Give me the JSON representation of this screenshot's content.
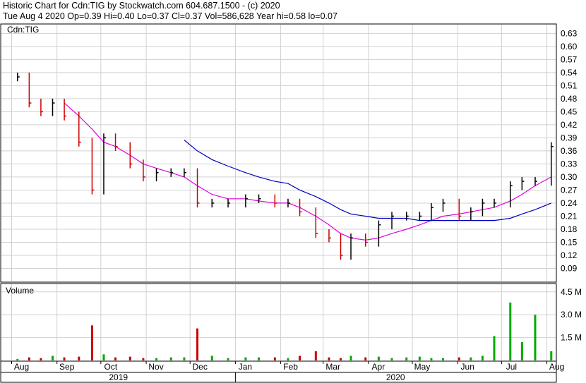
{
  "header": {
    "line1": "Historic Chart for Cdn:TIG by Stockwatch.com 604.687.1500 - (c) 2020",
    "line2": "Tue Aug  4 2020  Op=0.39  Hi=0.40  Lo=0.37  Cl=0.37  Vol=586,628  Year hi=0.58  lo=0.07"
  },
  "chart_data": [
    {
      "type": "ohlc",
      "title": "Cdn:TIG",
      "xlabel": "",
      "ylabel": "",
      "x": [
        "2019-08-05",
        "2019-08-13",
        "2019-08-21",
        "2019-08-29",
        "2019-09-06",
        "2019-09-16",
        "2019-09-25",
        "2019-10-03",
        "2019-10-11",
        "2019-10-21",
        "2019-10-30",
        "2019-11-08",
        "2019-11-18",
        "2019-11-27",
        "2019-12-06",
        "2019-12-16",
        "2019-12-27",
        "2020-01-08",
        "2020-01-17",
        "2020-01-28",
        "2020-02-06",
        "2020-02-14",
        "2020-02-25",
        "2020-03-05",
        "2020-03-13",
        "2020-03-20",
        "2020-03-30",
        "2020-04-08",
        "2020-04-17",
        "2020-04-27",
        "2020-05-06",
        "2020-05-14",
        "2020-05-22",
        "2020-06-02",
        "2020-06-10",
        "2020-06-18",
        "2020-06-26",
        "2020-07-07",
        "2020-07-15",
        "2020-07-24",
        "2020-08-04"
      ],
      "close": [
        0.53,
        0.47,
        0.45,
        0.47,
        0.44,
        0.38,
        0.27,
        0.39,
        0.37,
        0.33,
        0.3,
        0.31,
        0.31,
        0.31,
        0.24,
        0.24,
        0.24,
        0.25,
        0.25,
        0.24,
        0.24,
        0.22,
        0.17,
        0.16,
        0.12,
        0.16,
        0.15,
        0.19,
        0.21,
        0.21,
        0.21,
        0.23,
        0.24,
        0.21,
        0.22,
        0.24,
        0.24,
        0.28,
        0.29,
        0.29,
        0.37
      ],
      "volume_millions": [
        0.1,
        0.2,
        0.15,
        0.3,
        0.2,
        0.25,
        2.3,
        0.4,
        0.2,
        0.25,
        0.15,
        0.15,
        0.2,
        0.2,
        2.1,
        0.3,
        0.15,
        0.2,
        0.2,
        0.2,
        0.15,
        0.3,
        0.6,
        0.2,
        0.15,
        0.3,
        0.2,
        0.25,
        0.15,
        0.2,
        0.25,
        0.15,
        0.15,
        0.2,
        0.2,
        0.3,
        1.6,
        3.8,
        1.2,
        3.0,
        0.6
      ],
      "moving_averages": [
        {
          "color": "#e000e0",
          "values": [
            null,
            null,
            null,
            null,
            0.47,
            0.44,
            0.41,
            0.38,
            0.37,
            0.35,
            0.33,
            0.32,
            0.31,
            0.3,
            0.28,
            0.26,
            0.25,
            0.25,
            0.245,
            0.24,
            0.24,
            0.23,
            0.21,
            0.19,
            0.17,
            0.16,
            0.155,
            0.16,
            0.17,
            0.18,
            0.19,
            0.2,
            0.21,
            0.215,
            0.22,
            0.225,
            0.23,
            0.245,
            0.26,
            0.28,
            0.3
          ]
        },
        {
          "color": "#0000c0",
          "values": [
            null,
            null,
            null,
            null,
            null,
            null,
            null,
            null,
            null,
            null,
            null,
            null,
            null,
            0.385,
            0.36,
            0.34,
            0.325,
            0.31,
            0.3,
            0.29,
            0.285,
            0.27,
            0.255,
            0.24,
            0.225,
            0.215,
            0.21,
            0.205,
            0.205,
            0.205,
            0.2,
            0.2,
            0.2,
            0.2,
            0.2,
            0.2,
            0.2,
            0.205,
            0.215,
            0.225,
            0.24
          ]
        }
      ],
      "y_ticks": [
        "0.09",
        "0.12",
        "0.15",
        "0.18",
        "0.21",
        "0.24",
        "0.27",
        "0.30",
        "0.33",
        "0.36",
        "0.39",
        "0.42",
        "0.45",
        "0.48",
        "0.51",
        "0.54",
        "0.57",
        "0.60",
        "0.63"
      ],
      "ylim": [
        0.06,
        0.65
      ],
      "volume_label": "Volume",
      "volume_ticks": [
        "1.5 M",
        "3.0 M",
        "4.5 M"
      ],
      "months": [
        "Aug",
        "Sep",
        "Oct",
        "Nov",
        "Dec",
        "Jan",
        "Feb",
        "Mar",
        "Apr",
        "May",
        "Jun",
        "Jul",
        "Aug"
      ],
      "years": [
        "2019",
        "2020"
      ],
      "colors": {
        "ma_fast": "#e000e0",
        "ma_slow": "#0000c0",
        "bar_up": "#000000",
        "bar_down": "#cc0000",
        "volume_up": "#00aa00",
        "volume_down": "#cc0000",
        "grid": "#d0d0d0"
      }
    }
  ]
}
